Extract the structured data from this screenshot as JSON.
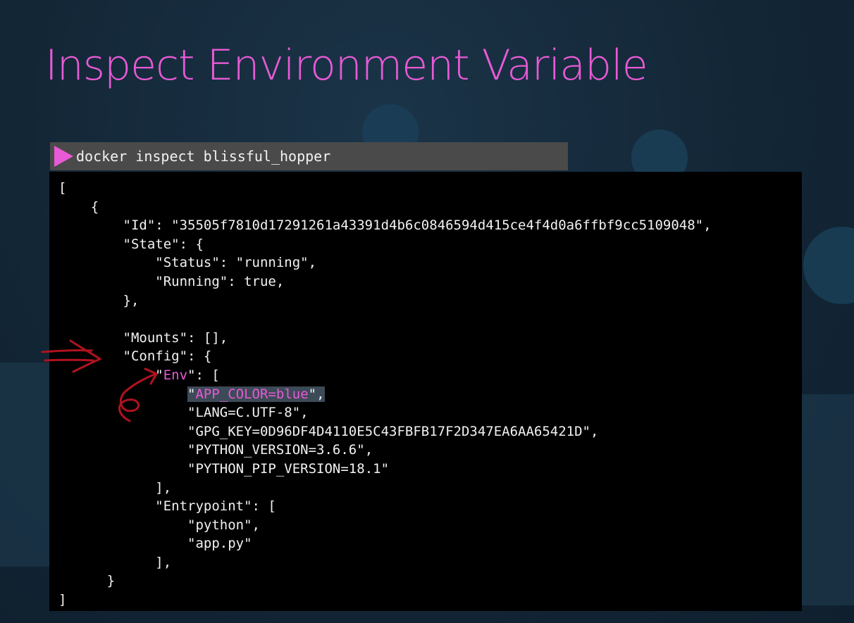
{
  "slide": {
    "title": "Inspect Environment Variable"
  },
  "command": {
    "text": "docker inspect blissful_hopper"
  },
  "output": {
    "open_bracket": "[",
    "open_brace": "{",
    "id_line": "\"Id\": \"35505f7810d17291261a43391d4b6c0846594d415ce4f4d0a6ffbf9cc5109048\",",
    "state_open": "\"State\": {",
    "status_line": "\"Status\": \"running\",",
    "running_line": "\"Running\": true,",
    "state_close": "},",
    "mounts_line": "\"Mounts\": [],",
    "config_open": "\"Config\": {",
    "env_key": "Env",
    "env_rest": ": [",
    "env_values": {
      "app_color": "APP_COLOR=blue",
      "lang": "\"LANG=C.UTF-8\",",
      "gpg_key": "\"GPG_KEY=0D96DF4D4110E5C43FBFB17F2D347EA6AA65421D\",",
      "python_version": "\"PYTHON_VERSION=3.6.6\",",
      "python_pip_version": "\"PYTHON_PIP_VERSION=18.1\""
    },
    "env_close": "],",
    "entrypoint_open": "\"Entrypoint\": [",
    "entrypoint_values": {
      "python": "\"python\",",
      "app": "\"app.py\""
    },
    "entrypoint_close": "],",
    "close_brace": "}",
    "close_bracket": "]"
  },
  "colors": {
    "title": "#e85ad6",
    "highlight_text": "#e85ad6",
    "annotation_ink": "#b0121f",
    "terminal_bg": "#000000",
    "command_bar_bg": "#4a4a4a"
  },
  "icons": {
    "prompt": "play-triangle-icon",
    "annotations": [
      "hand-drawn-arrow-icon",
      "hand-drawn-scribble-icon"
    ]
  }
}
